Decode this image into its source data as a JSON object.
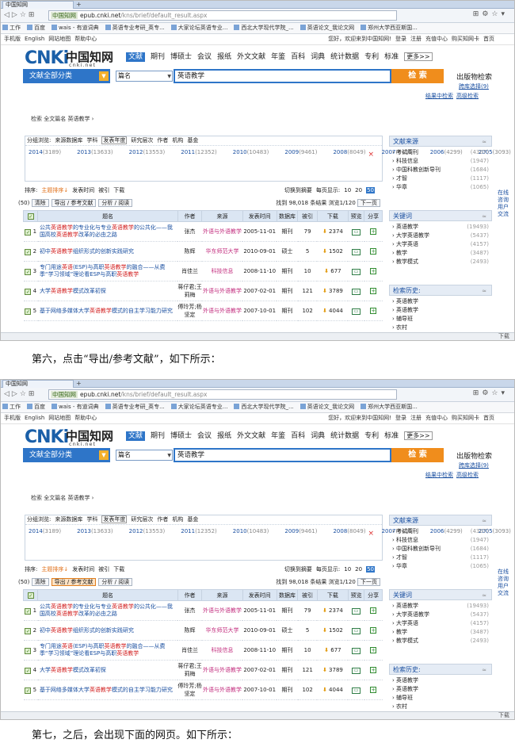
{
  "browser": {
    "tab_title": "中国知网",
    "url_site": "中国知网",
    "url_host": "epub.cnki.net",
    "url_path": "/kns/brief/default_result.aspx",
    "bookmarks": [
      "工作",
      "百度",
      "wais - 有道词典",
      "英语专业考研_英专...",
      "大家论坛英语专业...",
      "西北大学现代学院_...",
      "英语论文_我论文网",
      "郑州大学西亚斯国..."
    ]
  },
  "topbar": {
    "left": [
      "手机版",
      "English",
      "网站地图",
      "帮助中心"
    ],
    "right": [
      "您好，欢迎来到中国知网!",
      "登录",
      "注册",
      "充值中心",
      "购买知网卡",
      "首页"
    ]
  },
  "logo": {
    "mark": "CNKi",
    "cn": "中国知网",
    "url": "cnki.net"
  },
  "nav": {
    "active": "文献",
    "items": [
      "期刊",
      "博硕士",
      "会议",
      "报纸",
      "外文文献",
      "年鉴",
      "百科",
      "词典",
      "统计数据",
      "专利",
      "标准"
    ],
    "more": "更多>>"
  },
  "search": {
    "category": "文献全部分类",
    "field": "篇名",
    "query": "英语教学",
    "button": "检 索",
    "pub_search": "出版物检索",
    "std_select": "跨库选择(9)",
    "adv_links": [
      "结果中检索",
      "高级检索"
    ]
  },
  "crumb": "检索  全文篇名 英语教学  ›",
  "grouping": {
    "tabs": [
      "分组浏览:",
      "来源数据库",
      "学科",
      "发表年度",
      "研究层次",
      "作者",
      "机构",
      "基金"
    ],
    "selected": "发表年度",
    "years": [
      [
        "2014",
        "(3189)"
      ],
      [
        "2013",
        "(13633)"
      ],
      [
        "2012",
        "(13553)"
      ],
      [
        "2011",
        "(12352)"
      ],
      [
        "2010",
        "(10483)"
      ],
      [
        "2009",
        "(9461)"
      ],
      [
        "2008",
        "(8049)"
      ],
      [
        "2007",
        "(6435)"
      ],
      [
        "2006",
        "(4299)"
      ],
      [
        "2005",
        "(3093)"
      ],
      [
        "2004",
        "(2445)"
      ],
      [
        "2003",
        "(2190)"
      ],
      [
        "2002",
        "(1788)"
      ],
      [
        "2001",
        "(1418)"
      ],
      [
        "2000",
        "(1154)"
      ]
    ],
    "more": ">>",
    "close": "×"
  },
  "sort": {
    "label": "排序:",
    "hot": "主题排序",
    "items": [
      "发表时间",
      "被引",
      "下载"
    ],
    "switch": "切换到摘要",
    "per_page": "每页显示:",
    "sizes": [
      "10",
      "20"
    ],
    "size_active": "50"
  },
  "actions": {
    "selected": "(50)",
    "buttons": [
      "清除",
      "导出 / 参考文献",
      "分析 / 阅读"
    ],
    "found": "找到 98,018 条结果",
    "pager": "浏览1/120",
    "next": "下一页"
  },
  "table": {
    "headers": [
      "",
      "题名",
      "作者",
      "来源",
      "发表时间",
      "数据库",
      "被引",
      "下载",
      "预览",
      "分享"
    ],
    "rows": [
      {
        "n": "1",
        "t1": "公共",
        "kw1": "英语教学",
        "t2": "的专业化与专业",
        "kw2": "英语教学",
        "t3": "的公共化——我国高校",
        "kw3": "英语教学",
        "t4": "改革的必由之路",
        "author": "张杰",
        "source": "外语与外语教学",
        "date": "2005-11-01",
        "db": "期刊",
        "cited": "79",
        "dl": "2374"
      },
      {
        "n": "2",
        "t1": "初中",
        "kw1": "英语教学",
        "t2": "组织形式的创新实践研究",
        "kw2": "",
        "t3": "",
        "kw3": "",
        "t4": "",
        "author": "陈辉",
        "source": "华东师范大学",
        "date": "2010-09-01",
        "db": "硕士",
        "cited": "5",
        "dl": "1502"
      },
      {
        "n": "3",
        "t1": "专门用途",
        "kw1": "英语",
        "t2": "(ESP)与高职",
        "kw2": "英语教学",
        "t3": "的融合——从费季“学习领域”理论看ESP与高职",
        "kw3": "英语教学",
        "t4": "",
        "author": "肖佳兰",
        "source": "科技信息",
        "date": "2008-11-10",
        "db": "期刊",
        "cited": "10",
        "dl": "677"
      },
      {
        "n": "4",
        "t1": "大学",
        "kw1": "英语教学",
        "t2": "模式改革初探",
        "kw2": "",
        "t3": "",
        "kw3": "",
        "t4": "",
        "author": "蒋仔君;王莉梅",
        "source": "外语与外语教学",
        "date": "2007-02-01",
        "db": "期刊",
        "cited": "121",
        "dl": "3789"
      },
      {
        "n": "5",
        "t1": "基于网络多媒体大学",
        "kw1": "英语教学",
        "t2": "模式的自主学习能力研究",
        "kw2": "",
        "t3": "",
        "kw3": "",
        "t4": "",
        "author": "傅玲芳;杨坚定",
        "source": "外语与外语教学",
        "date": "2007-10-01",
        "db": "期刊",
        "cited": "102",
        "dl": "4044"
      }
    ]
  },
  "side": {
    "source_title": "文献来源",
    "sources": [
      [
        "考试周刊",
        "(4307)"
      ],
      [
        "科技信息",
        "(1947)"
      ],
      [
        "中国科教创新导刊",
        "(1684)"
      ],
      [
        "才智",
        "(1117)"
      ],
      [
        "华章",
        "(1065)"
      ]
    ],
    "kw_title": "关键词",
    "keywords": [
      [
        "英语教学",
        "(19493)"
      ],
      [
        "大学英语教学",
        "(5437)"
      ],
      [
        "大学英语",
        "(4157)"
      ],
      [
        "教学",
        "(3487)"
      ],
      [
        "教学模式",
        "(2493)"
      ]
    ],
    "history_title": "检索历史:",
    "history": [
      "英语教学",
      "英语教学",
      "辅导班",
      "农村"
    ]
  },
  "far_right": [
    "在线",
    "咨询",
    "用户",
    "交流"
  ],
  "statusbar": "下载",
  "doc": {
    "step6": "第六，点击“导出/参考文献”，如下所示：",
    "step7": "第七，之后，会出现下面的网页。如下所示："
  }
}
